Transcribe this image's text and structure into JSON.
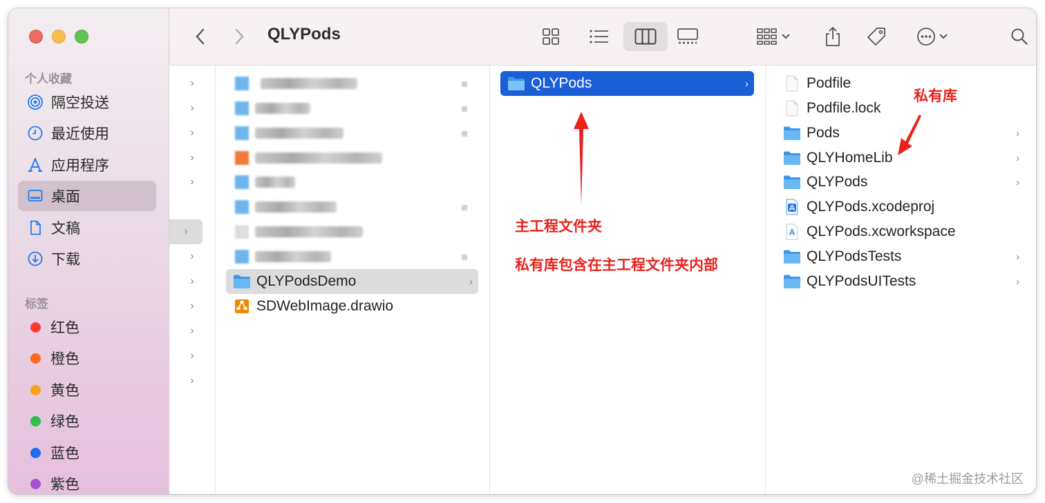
{
  "window": {
    "title": "QLYPods"
  },
  "sidebar": {
    "favorites_header": "个人收藏",
    "favorites": [
      {
        "label": "隔空投送",
        "icon": "airdrop-icon"
      },
      {
        "label": "最近使用",
        "icon": "clock-icon"
      },
      {
        "label": "应用程序",
        "icon": "applications-icon"
      },
      {
        "label": "桌面",
        "icon": "desktop-icon",
        "selected": true
      },
      {
        "label": "文稿",
        "icon": "document-icon"
      },
      {
        "label": "下载",
        "icon": "download-icon"
      }
    ],
    "tags_header": "标签",
    "tags": [
      {
        "label": "红色",
        "color": "#ff3b30"
      },
      {
        "label": "橙色",
        "color": "#ff8c1a"
      },
      {
        "label": "黄色",
        "color": "#f7c21b"
      },
      {
        "label": "绿色",
        "color": "#2fbf4a"
      },
      {
        "label": "蓝色",
        "color": "#1f7cf2"
      },
      {
        "label": "紫色",
        "color": "#b155d9"
      }
    ]
  },
  "toolbar": {
    "icons": [
      "back-icon",
      "forward-icon",
      "icon-view-icon",
      "list-view-icon",
      "column-view-icon",
      "gallery-view-icon",
      "group-icon",
      "share-icon",
      "tag-icon",
      "more-icon",
      "search-icon"
    ],
    "active_view": "column"
  },
  "column2": {
    "items": [
      {
        "name": "QLYPodsDemo",
        "type": "folder",
        "selected": true
      },
      {
        "name": "SDWebImage.drawio",
        "type": "drawio"
      }
    ]
  },
  "column3": {
    "items": [
      {
        "name": "QLYPods",
        "type": "folder",
        "selected": true
      }
    ]
  },
  "column4": {
    "items": [
      {
        "name": "Podfile",
        "type": "file"
      },
      {
        "name": "Podfile.lock",
        "type": "file"
      },
      {
        "name": "Pods",
        "type": "folder"
      },
      {
        "name": "QLYHomeLib",
        "type": "folder"
      },
      {
        "name": "QLYPods",
        "type": "folder"
      },
      {
        "name": "QLYPods.xcodeproj",
        "type": "xcodeproj"
      },
      {
        "name": "QLYPods.xcworkspace",
        "type": "xcworkspace"
      },
      {
        "name": "QLYPodsTests",
        "type": "folder"
      },
      {
        "name": "QLYPodsUITests",
        "type": "folder"
      }
    ]
  },
  "annotations": {
    "main_project": "主工程文件夹",
    "private_in_main": "私有库包含在主工程文件夹内部",
    "private_lib": "私有库"
  },
  "watermark": "@稀土掘金技术社区",
  "colors": {
    "selection_blue": "#1a5ed8",
    "annotation_red": "#e8221d",
    "folder_blue": "#5aaef0"
  }
}
